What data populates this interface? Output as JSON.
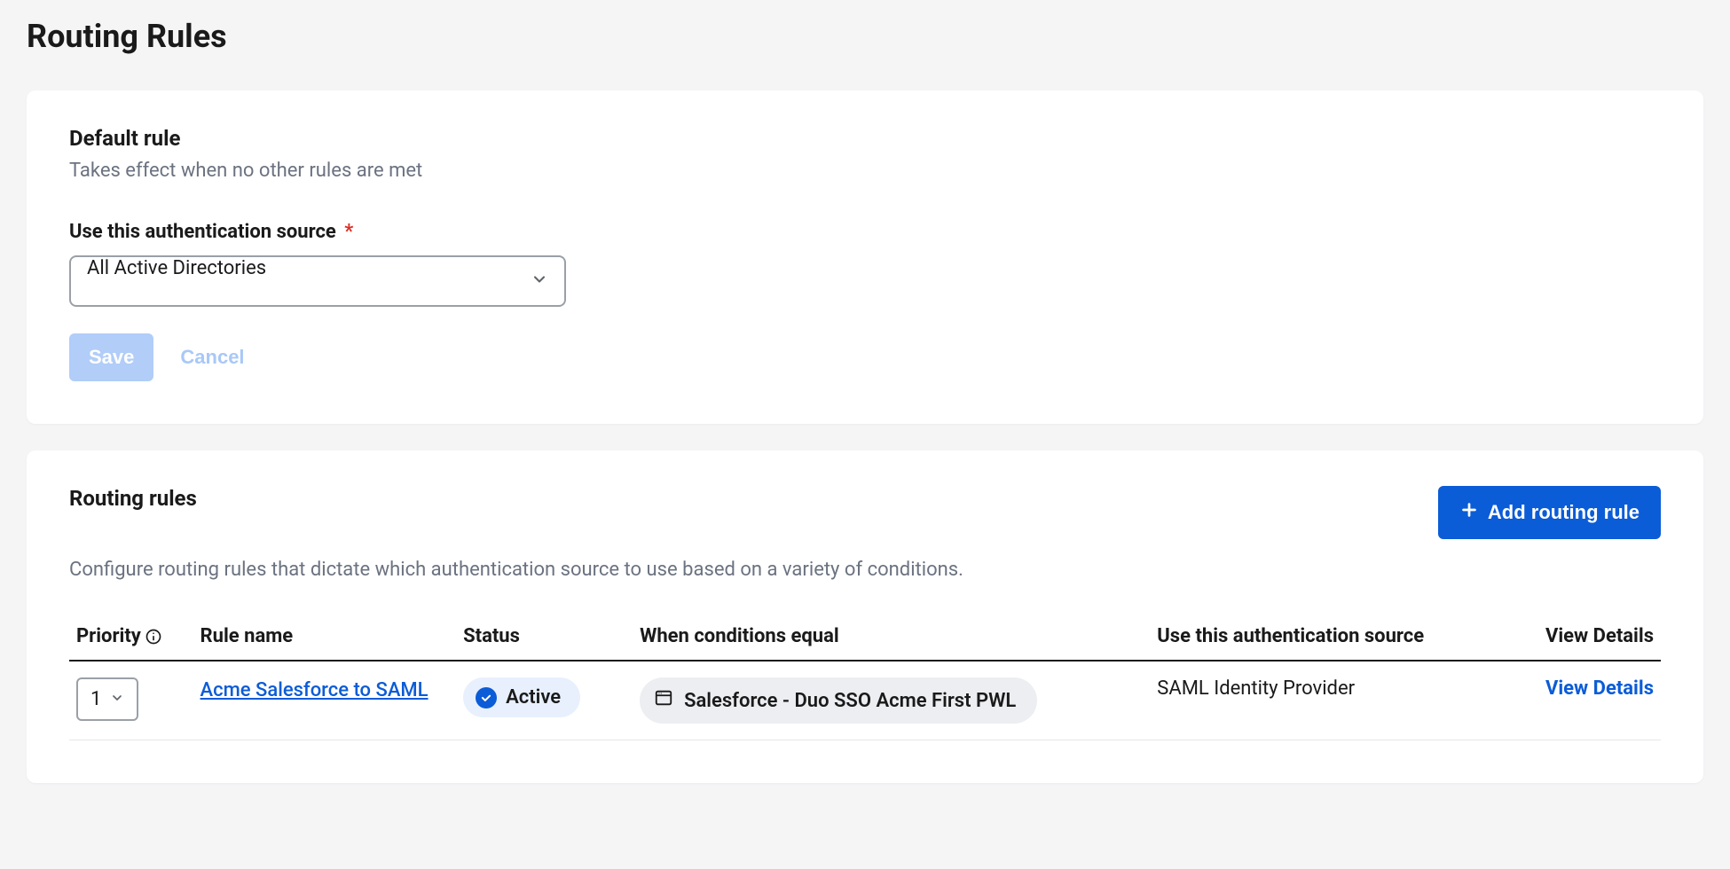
{
  "page": {
    "title": "Routing Rules"
  },
  "default_rule": {
    "heading": "Default rule",
    "description": "Takes effect when no other rules are met",
    "field_label": "Use this authentication source",
    "required_mark": "*",
    "selected_source": "All Active Directories",
    "save_label": "Save",
    "cancel_label": "Cancel"
  },
  "routing_section": {
    "heading": "Routing rules",
    "description": "Configure routing rules that dictate which authentication source to use based on a variety of conditions.",
    "add_button_label": "Add routing rule",
    "columns": {
      "priority": "Priority",
      "rule_name": "Rule name",
      "status": "Status",
      "conditions": "When conditions equal",
      "auth_source": "Use this authentication source",
      "view": "View Details"
    },
    "row": {
      "priority": "1",
      "rule_name": "Acme Salesforce to SAML",
      "status": "Active",
      "condition": "Salesforce - Duo SSO Acme First PWL",
      "auth_source": "SAML Identity Provider",
      "view_label": "View Details"
    }
  }
}
